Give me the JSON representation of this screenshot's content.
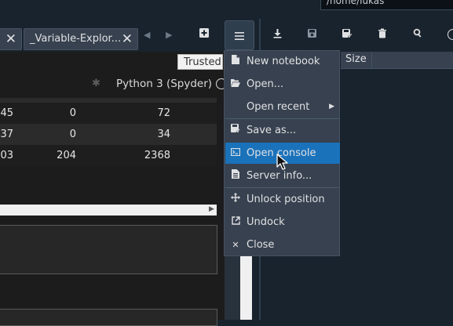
{
  "path_bar": {
    "text": "/home/lukas"
  },
  "tabs": [
    {
      "label": ""
    },
    {
      "label": "_Variable-Explor..."
    }
  ],
  "notebook": {
    "trusted_label": "Trusted",
    "kernel_name": "Python 3 (Spyder)",
    "rows": [
      {
        "c1": "45",
        "c2": "0",
        "c3": "72"
      },
      {
        "c1": "37",
        "c2": "0",
        "c3": "34"
      },
      {
        "c1": "03",
        "c2": "204",
        "c3": "2368"
      }
    ]
  },
  "file_explorer": {
    "size_header": "Size"
  },
  "menu": {
    "items": [
      {
        "icon": "new-file-icon",
        "label": "New notebook"
      },
      {
        "icon": "folder-open-icon",
        "label": "Open..."
      },
      {
        "icon": "",
        "label": "Open recent",
        "submenu": true
      },
      {
        "icon": "save-as-icon",
        "label": "Save as..."
      },
      {
        "icon": "console-icon",
        "label": "Open console",
        "active": true
      },
      {
        "icon": "file-info-icon",
        "label": "Server info..."
      },
      {
        "icon": "move-icon",
        "label": "Unlock position"
      },
      {
        "icon": "external-link-icon",
        "label": "Undock"
      },
      {
        "icon": "close-icon",
        "label": "Close"
      }
    ]
  },
  "colors": {
    "background": "#19232d",
    "menu_bg": "#37414f",
    "menu_active": "#1a72bb",
    "notebook_bg": "#1c1c1c"
  }
}
